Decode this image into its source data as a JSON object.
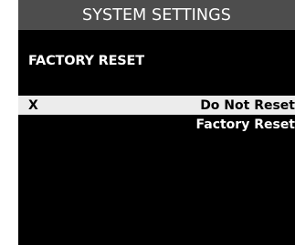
{
  "header": {
    "title": "SYSTEM SETTINGS"
  },
  "section": {
    "title": "FACTORY RESET"
  },
  "options": [
    {
      "marker": "X",
      "label": "Do Not Reset",
      "selected": true
    },
    {
      "marker": "",
      "label": "Factory Reset",
      "selected": false
    }
  ],
  "colors": {
    "screen_background": "#000000",
    "header_background": "#4d4d4d",
    "selected_row": "#ececec",
    "text": "#ffffff"
  }
}
